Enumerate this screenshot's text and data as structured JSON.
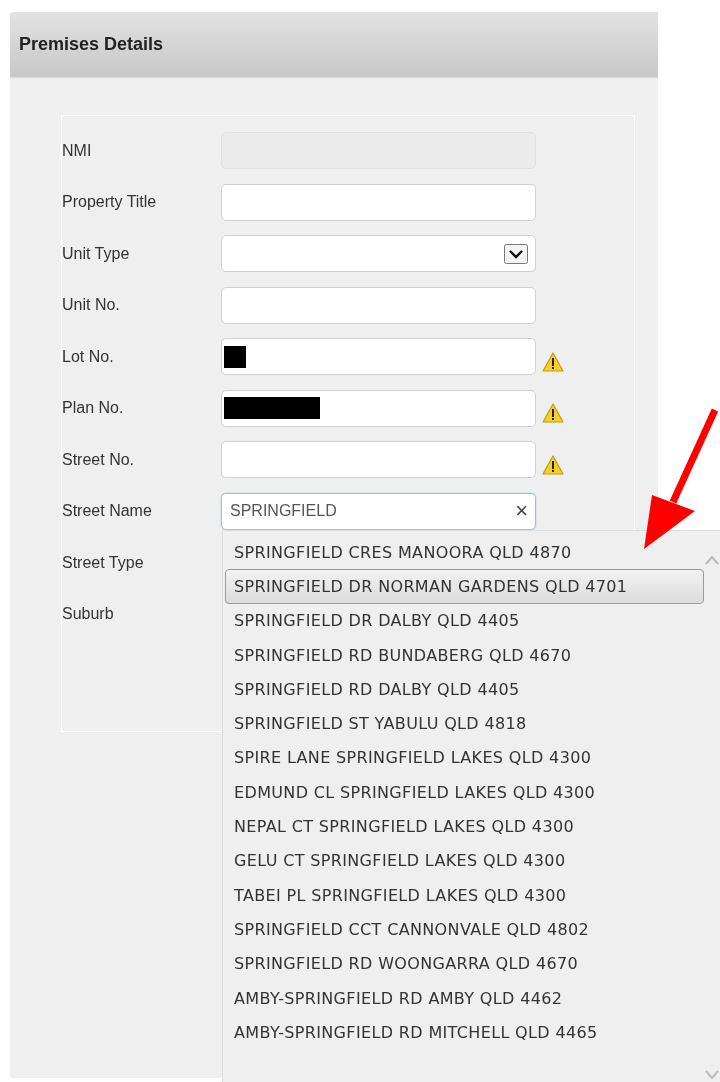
{
  "panel": {
    "title": "Premises Details"
  },
  "fields": [
    {
      "label": "NMI",
      "kind": "disabled",
      "warning": false
    },
    {
      "label": "Property Title",
      "kind": "text",
      "warning": false
    },
    {
      "label": "Unit Type",
      "kind": "select",
      "warning": false
    },
    {
      "label": "Unit No.",
      "kind": "text",
      "warning": false
    },
    {
      "label": "Lot No.",
      "kind": "text",
      "warning": true,
      "redacted": true,
      "redaction_wide": false
    },
    {
      "label": "Plan No.",
      "kind": "text",
      "warning": true,
      "redacted": true,
      "redaction_wide": true
    },
    {
      "label": "Street No.",
      "kind": "text",
      "warning": true
    },
    {
      "label": "Street Name",
      "kind": "search",
      "warning": false,
      "value": "SPRINGFIELD",
      "clear": "×"
    },
    {
      "label": "Street Type",
      "kind": "covered",
      "warning": false
    },
    {
      "label": "Suburb",
      "kind": "covered",
      "warning": false
    }
  ],
  "suggestions": [
    {
      "text": "SPRINGFIELD CRES MANOORA QLD 4870",
      "selected": false
    },
    {
      "text": "SPRINGFIELD DR NORMAN GARDENS QLD 4701",
      "selected": true
    },
    {
      "text": "SPRINGFIELD DR DALBY QLD 4405",
      "selected": false
    },
    {
      "text": "SPRINGFIELD RD BUNDABERG QLD 4670",
      "selected": false
    },
    {
      "text": "SPRINGFIELD RD DALBY QLD 4405",
      "selected": false
    },
    {
      "text": "SPRINGFIELD ST YABULU QLD 4818",
      "selected": false
    },
    {
      "text": "SPIRE LANE SPRINGFIELD LAKES QLD 4300",
      "selected": false
    },
    {
      "text": "EDMUND CL SPRINGFIELD LAKES QLD 4300",
      "selected": false
    },
    {
      "text": "NEPAL CT SPRINGFIELD LAKES QLD 4300",
      "selected": false
    },
    {
      "text": "GELU CT SPRINGFIELD LAKES QLD 4300",
      "selected": false
    },
    {
      "text": "TABEI PL SPRINGFIELD LAKES QLD 4300",
      "selected": false
    },
    {
      "text": "SPRINGFIELD CCT CANNONVALE QLD 4802",
      "selected": false
    },
    {
      "text": "SPRINGFIELD RD WOONGARRA QLD 4670",
      "selected": false
    },
    {
      "text": "AMBY-SPRINGFIELD RD AMBY QLD 4462",
      "selected": false
    },
    {
      "text": "AMBY-SPRINGFIELD RD MITCHELL QLD 4465",
      "selected": false
    }
  ]
}
